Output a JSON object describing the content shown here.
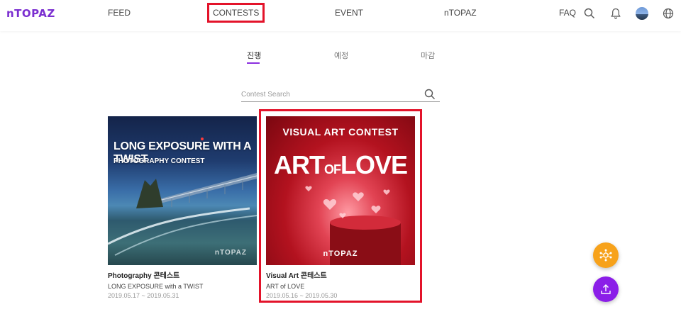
{
  "header": {
    "logo": "nTOPAZ",
    "nav": [
      "FEED",
      "CONTESTS",
      "EVENT",
      "nTOPAZ"
    ],
    "faq_label": "FAQ",
    "icons": [
      "search-icon",
      "bell-icon",
      "avatar",
      "globe-icon"
    ]
  },
  "tabs": {
    "items": [
      "진행",
      "예정",
      "마감"
    ],
    "active": "진행"
  },
  "search": {
    "placeholder": "Contest Search",
    "value": ""
  },
  "contests": [
    {
      "category": "Photography 콘테스트",
      "title": "LONG EXPOSURE with a TWIST",
      "date": "2019.05.17 ~ 2019.05.31",
      "image_text_main": "LONG EXPOSURE WITH A TWIST",
      "image_text_sub": "PHOTOGRAPHY CONTEST",
      "image_logo": "nTOPAZ"
    },
    {
      "category": "Visual Art 콘테스트",
      "title": "ART of LOVE",
      "date": "2019.05.16 ~ 2019.05.30",
      "image_text_top": "VISUAL ART CONTEST",
      "image_text_art": "ART",
      "image_text_of": "OF",
      "image_text_love": "LOVE",
      "image_logo": "nTOPAZ"
    }
  ],
  "fab": {
    "top_color": "#f7a21b",
    "bottom_color": "#8b1ee8"
  },
  "colors": {
    "accent": "#8b2fe0",
    "highlight": "#e3132a"
  }
}
